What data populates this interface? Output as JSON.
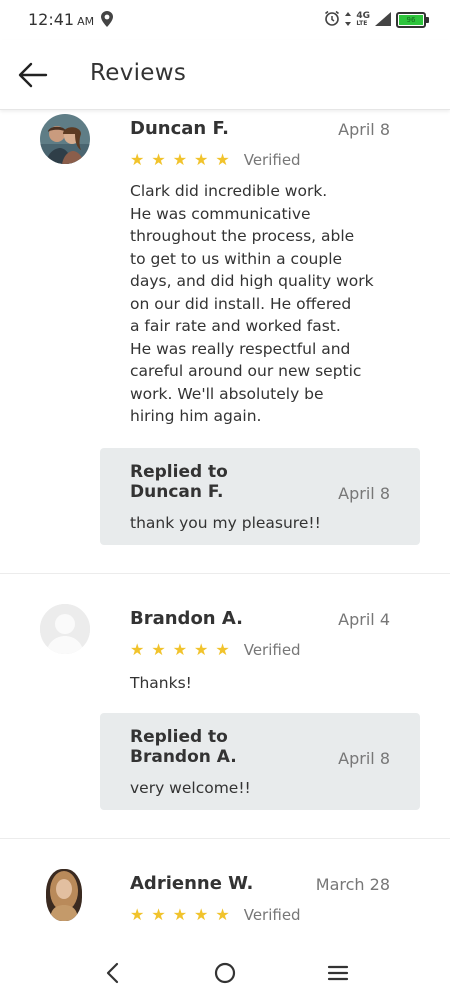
{
  "status_bar": {
    "time": "12:41",
    "ampm": "AM",
    "network": "4G",
    "network_sub": "LTE",
    "battery_text": "96"
  },
  "app_bar": {
    "title": "Reviews"
  },
  "reviews": [
    {
      "name": "Duncan F.",
      "date": "April 8",
      "rating": 5,
      "verified": "Verified",
      "text_lines": [
        "Clark did incredible work.",
        "He was communicative",
        "throughout the process, able",
        "to get to us within a couple",
        "days, and did high quality work",
        "on our did install. He offered",
        "a fair rate and worked fast.",
        "He was really respectful and",
        "careful around our new septic",
        "work. We'll absolutely be",
        "hiring him again."
      ],
      "reply": {
        "heading_line1": "Replied to",
        "heading_line2": "Duncan F.",
        "date": "April 8",
        "text": "thank you my pleasure!!"
      }
    },
    {
      "name": "Brandon A.",
      "date": "April 4",
      "rating": 5,
      "verified": "Verified",
      "text_lines": [
        "Thanks!"
      ],
      "reply": {
        "heading_line1": "Replied to",
        "heading_line2": "Brandon A.",
        "date": "April 8",
        "text": "very welcome!!"
      }
    },
    {
      "name": "Adrienne W.",
      "date": "March 28",
      "rating": 5,
      "verified": "Verified"
    }
  ],
  "star_color": "#f1c32c",
  "icons": {
    "back": "arrow-left-icon",
    "nav_back": "chevron-left-icon",
    "nav_home": "circle-home-icon",
    "nav_menu": "menu-icon"
  }
}
